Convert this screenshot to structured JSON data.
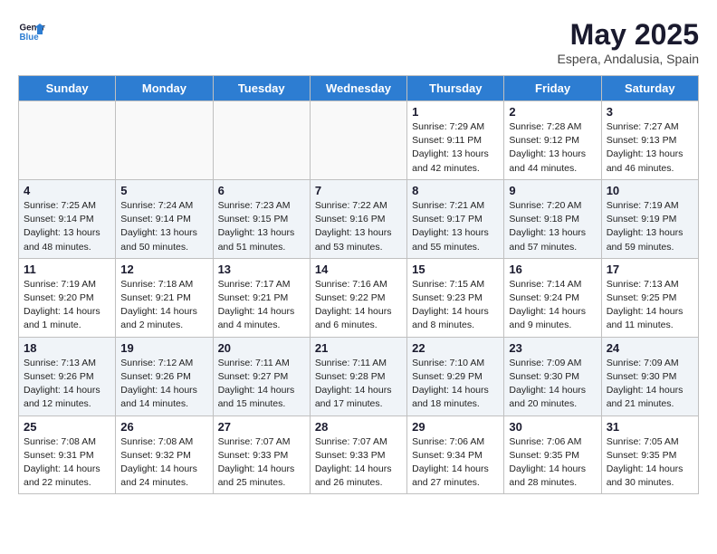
{
  "logo": {
    "line1": "General",
    "line2": "Blue"
  },
  "title": "May 2025",
  "subtitle": "Espera, Andalusia, Spain",
  "weekdays": [
    "Sunday",
    "Monday",
    "Tuesday",
    "Wednesday",
    "Thursday",
    "Friday",
    "Saturday"
  ],
  "weeks": [
    [
      {
        "day": "",
        "info": ""
      },
      {
        "day": "",
        "info": ""
      },
      {
        "day": "",
        "info": ""
      },
      {
        "day": "",
        "info": ""
      },
      {
        "day": "1",
        "info": "Sunrise: 7:29 AM\nSunset: 9:11 PM\nDaylight: 13 hours\nand 42 minutes."
      },
      {
        "day": "2",
        "info": "Sunrise: 7:28 AM\nSunset: 9:12 PM\nDaylight: 13 hours\nand 44 minutes."
      },
      {
        "day": "3",
        "info": "Sunrise: 7:27 AM\nSunset: 9:13 PM\nDaylight: 13 hours\nand 46 minutes."
      }
    ],
    [
      {
        "day": "4",
        "info": "Sunrise: 7:25 AM\nSunset: 9:14 PM\nDaylight: 13 hours\nand 48 minutes."
      },
      {
        "day": "5",
        "info": "Sunrise: 7:24 AM\nSunset: 9:14 PM\nDaylight: 13 hours\nand 50 minutes."
      },
      {
        "day": "6",
        "info": "Sunrise: 7:23 AM\nSunset: 9:15 PM\nDaylight: 13 hours\nand 51 minutes."
      },
      {
        "day": "7",
        "info": "Sunrise: 7:22 AM\nSunset: 9:16 PM\nDaylight: 13 hours\nand 53 minutes."
      },
      {
        "day": "8",
        "info": "Sunrise: 7:21 AM\nSunset: 9:17 PM\nDaylight: 13 hours\nand 55 minutes."
      },
      {
        "day": "9",
        "info": "Sunrise: 7:20 AM\nSunset: 9:18 PM\nDaylight: 13 hours\nand 57 minutes."
      },
      {
        "day": "10",
        "info": "Sunrise: 7:19 AM\nSunset: 9:19 PM\nDaylight: 13 hours\nand 59 minutes."
      }
    ],
    [
      {
        "day": "11",
        "info": "Sunrise: 7:19 AM\nSunset: 9:20 PM\nDaylight: 14 hours\nand 1 minute."
      },
      {
        "day": "12",
        "info": "Sunrise: 7:18 AM\nSunset: 9:21 PM\nDaylight: 14 hours\nand 2 minutes."
      },
      {
        "day": "13",
        "info": "Sunrise: 7:17 AM\nSunset: 9:21 PM\nDaylight: 14 hours\nand 4 minutes."
      },
      {
        "day": "14",
        "info": "Sunrise: 7:16 AM\nSunset: 9:22 PM\nDaylight: 14 hours\nand 6 minutes."
      },
      {
        "day": "15",
        "info": "Sunrise: 7:15 AM\nSunset: 9:23 PM\nDaylight: 14 hours\nand 8 minutes."
      },
      {
        "day": "16",
        "info": "Sunrise: 7:14 AM\nSunset: 9:24 PM\nDaylight: 14 hours\nand 9 minutes."
      },
      {
        "day": "17",
        "info": "Sunrise: 7:13 AM\nSunset: 9:25 PM\nDaylight: 14 hours\nand 11 minutes."
      }
    ],
    [
      {
        "day": "18",
        "info": "Sunrise: 7:13 AM\nSunset: 9:26 PM\nDaylight: 14 hours\nand 12 minutes."
      },
      {
        "day": "19",
        "info": "Sunrise: 7:12 AM\nSunset: 9:26 PM\nDaylight: 14 hours\nand 14 minutes."
      },
      {
        "day": "20",
        "info": "Sunrise: 7:11 AM\nSunset: 9:27 PM\nDaylight: 14 hours\nand 15 minutes."
      },
      {
        "day": "21",
        "info": "Sunrise: 7:11 AM\nSunset: 9:28 PM\nDaylight: 14 hours\nand 17 minutes."
      },
      {
        "day": "22",
        "info": "Sunrise: 7:10 AM\nSunset: 9:29 PM\nDaylight: 14 hours\nand 18 minutes."
      },
      {
        "day": "23",
        "info": "Sunrise: 7:09 AM\nSunset: 9:30 PM\nDaylight: 14 hours\nand 20 minutes."
      },
      {
        "day": "24",
        "info": "Sunrise: 7:09 AM\nSunset: 9:30 PM\nDaylight: 14 hours\nand 21 minutes."
      }
    ],
    [
      {
        "day": "25",
        "info": "Sunrise: 7:08 AM\nSunset: 9:31 PM\nDaylight: 14 hours\nand 22 minutes."
      },
      {
        "day": "26",
        "info": "Sunrise: 7:08 AM\nSunset: 9:32 PM\nDaylight: 14 hours\nand 24 minutes."
      },
      {
        "day": "27",
        "info": "Sunrise: 7:07 AM\nSunset: 9:33 PM\nDaylight: 14 hours\nand 25 minutes."
      },
      {
        "day": "28",
        "info": "Sunrise: 7:07 AM\nSunset: 9:33 PM\nDaylight: 14 hours\nand 26 minutes."
      },
      {
        "day": "29",
        "info": "Sunrise: 7:06 AM\nSunset: 9:34 PM\nDaylight: 14 hours\nand 27 minutes."
      },
      {
        "day": "30",
        "info": "Sunrise: 7:06 AM\nSunset: 9:35 PM\nDaylight: 14 hours\nand 28 minutes."
      },
      {
        "day": "31",
        "info": "Sunrise: 7:05 AM\nSunset: 9:35 PM\nDaylight: 14 hours\nand 30 minutes."
      }
    ]
  ]
}
